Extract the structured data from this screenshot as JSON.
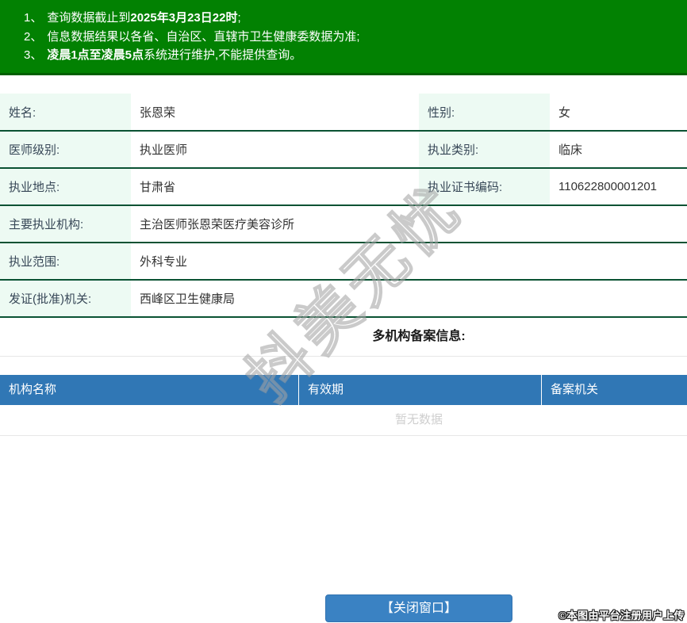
{
  "colors": {
    "banner_green": "#028102",
    "banner_border": "#015f01",
    "row_border_green": "#0a5233",
    "label_bg_mint": "#edfaf3",
    "header_blue": "#3077b5",
    "button_blue": "#3a82c3",
    "empty_text_gray": "#cfcfcf"
  },
  "banner": {
    "notices": [
      {
        "num": "1、",
        "pre": "查询数据截止到",
        "bold": "2025年3月23日22时",
        "post": ";"
      },
      {
        "num": "2、",
        "pre": "信息数据结果以各省、自治区、直辖市卫生健康委数据为准;",
        "bold": "",
        "post": ""
      },
      {
        "num": "3、",
        "pre": "",
        "bold": "凌晨1点至凌晨5点",
        "post": "系统进行维护,不能提供查询。"
      }
    ]
  },
  "info": {
    "rows": [
      {
        "cells": [
          {
            "label": "姓名:",
            "value": "张恩荣"
          },
          {
            "label": "性别:",
            "value": "女"
          }
        ]
      },
      {
        "cells": [
          {
            "label": "医师级别:",
            "value": "执业医师"
          },
          {
            "label": "执业类别:",
            "value": "临床"
          }
        ]
      },
      {
        "cells": [
          {
            "label": "执业地点:",
            "value": "甘肃省"
          },
          {
            "label": "执业证书编码:",
            "value": "110622800001201"
          }
        ]
      },
      {
        "cells": [
          {
            "label": "主要执业机构:",
            "value": "主治医师张恩荣医疗美容诊所"
          }
        ]
      },
      {
        "cells": [
          {
            "label": "执业范围:",
            "value": "外科专业"
          }
        ]
      },
      {
        "cells": [
          {
            "label": "发证(批准)机关:",
            "value": "西峰区卫生健康局"
          }
        ]
      }
    ]
  },
  "registration": {
    "title": "多机构备案信息:",
    "columns": [
      "机构名称",
      "有效期",
      "备案机关"
    ],
    "empty_text": "暂无数据"
  },
  "footer": {
    "close_button": "【关闭窗口】",
    "credit": "©本图由平台注册用户上传"
  },
  "watermark": {
    "text": "抖美无忧"
  }
}
